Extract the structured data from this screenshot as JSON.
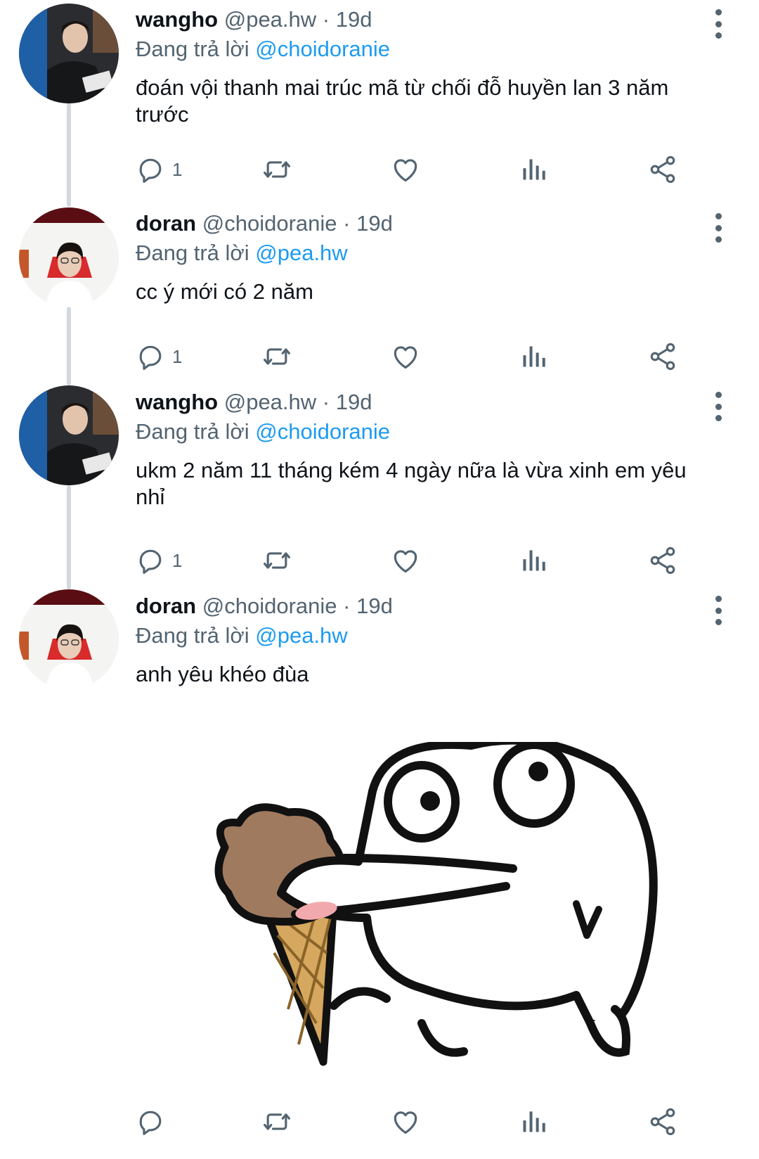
{
  "replies": [
    {
      "name": "wangho",
      "handle": "@pea.hw",
      "time": "19d",
      "replying_prefix": "Đang trả lời",
      "replying_to": "@choidoranie",
      "text_lines": [
        "đoán vội thanh mai trúc mã từ chối đỗ huyền lan 3 năm",
        "trước"
      ],
      "reply_count": "1"
    },
    {
      "name": "doran",
      "handle": "@choidoranie",
      "time": "19d",
      "replying_prefix": "Đang trả lời",
      "replying_to": "@pea.hw",
      "text_lines": [
        "cc ý mới có 2 năm"
      ],
      "reply_count": "1"
    },
    {
      "name": "wangho",
      "handle": "@pea.hw",
      "time": "19d",
      "replying_prefix": "Đang trả lời",
      "replying_to": "@choidoranie",
      "text_lines": [
        "ukm 2 năm 11 tháng kém 4 ngày nữa là vừa xinh em yêu",
        "nhỉ"
      ],
      "reply_count": "1"
    },
    {
      "name": "doran",
      "handle": "@choidoranie",
      "time": "19d",
      "replying_prefix": "Đang trả lời",
      "replying_to": "@pea.hw",
      "text_lines": [
        "anh yêu khéo đùa"
      ],
      "reply_count": ""
    }
  ],
  "separator": "·",
  "icons": {
    "reply": "reply-icon",
    "retweet": "retweet-icon",
    "like": "heart-icon",
    "views": "analytics-icon",
    "share": "share-icon",
    "more": "more-icon"
  },
  "media": {
    "kind": "sticker",
    "subject": "cartoon-blob-eating-ice-cream"
  },
  "colors": {
    "text": "#0f1419",
    "secondary": "#536471",
    "link": "#1d9bf0",
    "thread_line": "#cfd9de"
  }
}
